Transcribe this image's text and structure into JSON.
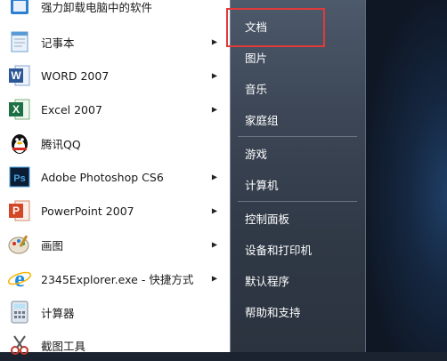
{
  "programs": [
    {
      "label": "强力卸载电脑中的软件",
      "icon": "uninstall-icon",
      "arrow": false
    },
    {
      "label": "记事本",
      "icon": "notepad-icon",
      "arrow": true
    },
    {
      "label": "WORD 2007",
      "icon": "word-icon",
      "arrow": true
    },
    {
      "label": "Excel 2007",
      "icon": "excel-icon",
      "arrow": true
    },
    {
      "label": "腾讯QQ",
      "icon": "qq-penguin-icon",
      "arrow": false
    },
    {
      "label": "Adobe Photoshop CS6",
      "icon": "photoshop-icon",
      "arrow": true
    },
    {
      "label": "PowerPoint 2007",
      "icon": "powerpoint-icon",
      "arrow": true
    },
    {
      "label": "画图",
      "icon": "paint-icon",
      "arrow": true
    },
    {
      "label": "2345Explorer.exe - 快捷方式",
      "icon": "ie-browser-icon",
      "arrow": true
    },
    {
      "label": "计算器",
      "icon": "calculator-icon",
      "arrow": false
    },
    {
      "label": "截图工具",
      "icon": "snipping-tool-icon",
      "arrow": false
    }
  ],
  "places": [
    {
      "label": "文档",
      "highlighted": true
    },
    {
      "label": "图片"
    },
    {
      "label": "音乐"
    },
    {
      "label": "家庭组"
    },
    {
      "label": "游戏"
    },
    {
      "label": "计算机"
    },
    {
      "label": "控制面板"
    },
    {
      "label": "设备和打印机"
    },
    {
      "label": "默认程序"
    },
    {
      "label": "帮助和支持"
    }
  ],
  "colors": {
    "highlight": "#e03a3a",
    "left_bg": "#ffffff",
    "right_bg": "#3d4757"
  }
}
